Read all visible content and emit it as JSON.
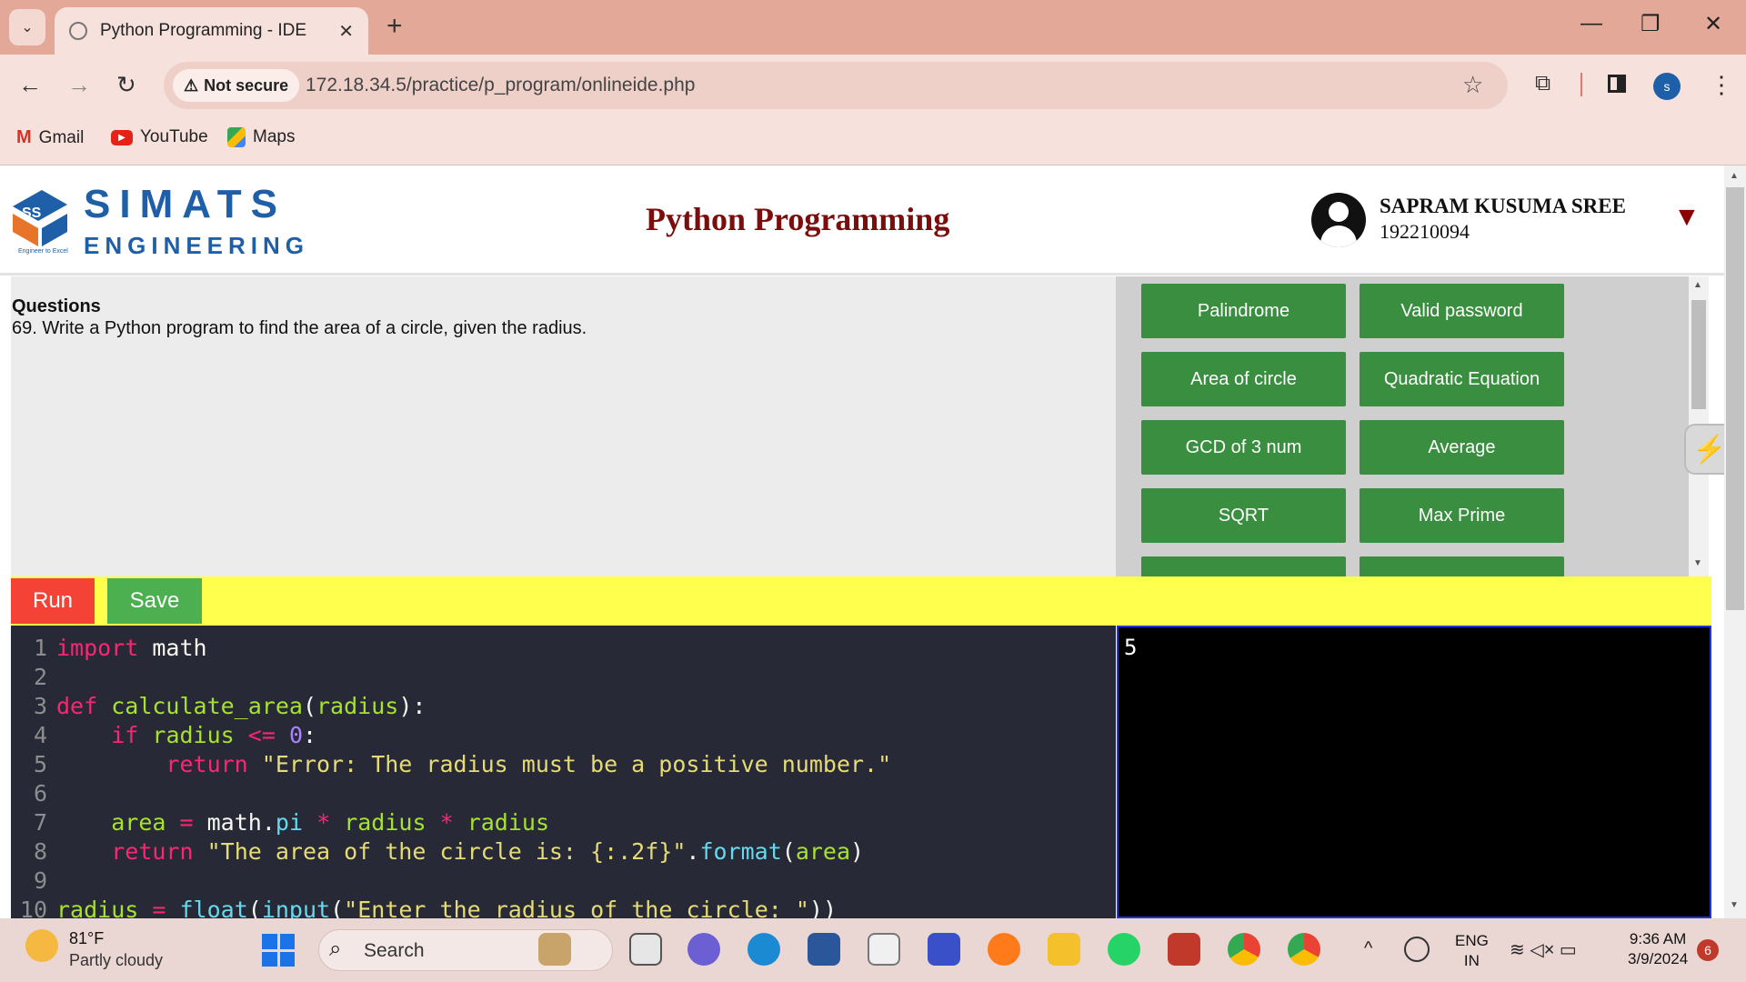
{
  "browser": {
    "tab_title": "Python Programming - IDE",
    "url": "172.18.34.5/practice/p_program/onlineide.php",
    "security_label": "Not secure",
    "profile_initial": "s",
    "bookmarks": [
      {
        "label": "Gmail",
        "icon": "gmail-icon"
      },
      {
        "label": "YouTube",
        "icon": "youtube-icon"
      },
      {
        "label": "Maps",
        "icon": "maps-icon"
      }
    ]
  },
  "header": {
    "logo_top": "SIMATS",
    "logo_bottom": "ENGINEERING",
    "logo_tagline": "Engineer to Excel",
    "title": "Python Programming",
    "user_name": "SAPRAM KUSUMA SREE",
    "user_id": "192210094"
  },
  "question": {
    "heading": "Questions",
    "text": "69. Write a Python program to find the area of a circle, given the radius."
  },
  "question_buttons": [
    "Palindrome",
    "Valid password",
    "Area of circle",
    "Quadratic Equation",
    "GCD of 3 num",
    "Average",
    "SQRT",
    "Max Prime"
  ],
  "actions": {
    "run": "Run",
    "save": "Save"
  },
  "editor": {
    "line_numbers": [
      "1",
      "2",
      "3",
      "4",
      "5",
      "6",
      "7",
      "8",
      "9",
      "10"
    ]
  },
  "output": {
    "text": "5"
  },
  "taskbar": {
    "weather_temp": "81°F",
    "weather_desc": "Partly cloudy",
    "search_placeholder": "Search",
    "lang_top": "ENG",
    "lang_bottom": "IN",
    "time": "9:36 AM",
    "date": "3/9/2024",
    "notification_count": "6"
  },
  "colors": {
    "accent_green": "#3a8e3f",
    "run_red": "#f44336",
    "runbar_yellow": "#ffff4d",
    "title_maroon": "#7b0d0d"
  }
}
